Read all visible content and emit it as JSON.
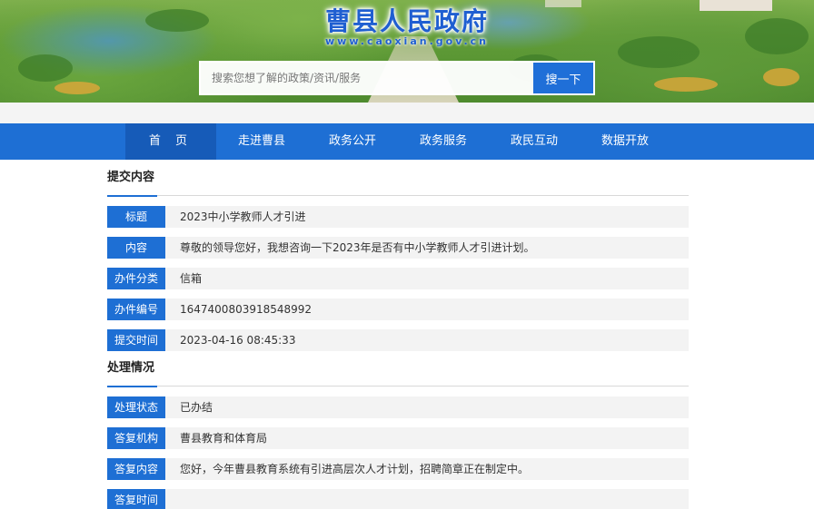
{
  "site": {
    "title": "曹县人民政府",
    "url": "www.caoxian.gov.cn"
  },
  "search": {
    "placeholder": "搜索您想了解的政策/资讯/服务",
    "button_label": "搜一下"
  },
  "nav": {
    "items": [
      {
        "label": "首 页"
      },
      {
        "label": "走进曹县"
      },
      {
        "label": "政务公开"
      },
      {
        "label": "政务服务"
      },
      {
        "label": "政民互动"
      },
      {
        "label": "数据开放"
      }
    ]
  },
  "submission": {
    "heading": "提交内容",
    "fields": [
      {
        "label": "标题",
        "value": "2023中小学教师人才引进"
      },
      {
        "label": "内容",
        "value": "尊敬的领导您好，我想咨询一下2023年是否有中小学教师人才引进计划。"
      },
      {
        "label": "办件分类",
        "value": "信箱"
      },
      {
        "label": "办件编号",
        "value": "1647400803918548992"
      },
      {
        "label": "提交时间",
        "value": "2023-04-16 08:45:33"
      }
    ]
  },
  "handling": {
    "heading": "处理情况",
    "fields": [
      {
        "label": "处理状态",
        "value": "已办结"
      },
      {
        "label": "答复机构",
        "value": "曹县教育和体育局"
      },
      {
        "label": "答复内容",
        "value": "您好，今年曹县教育系统有引进高层次人才计划，招聘简章正在制定中。"
      },
      {
        "label": "答复时间",
        "value": ""
      }
    ]
  },
  "colors": {
    "accent": "#1e6fd4",
    "title_blue": "#1f5fd1",
    "row_bg": "#f3f3f3"
  }
}
